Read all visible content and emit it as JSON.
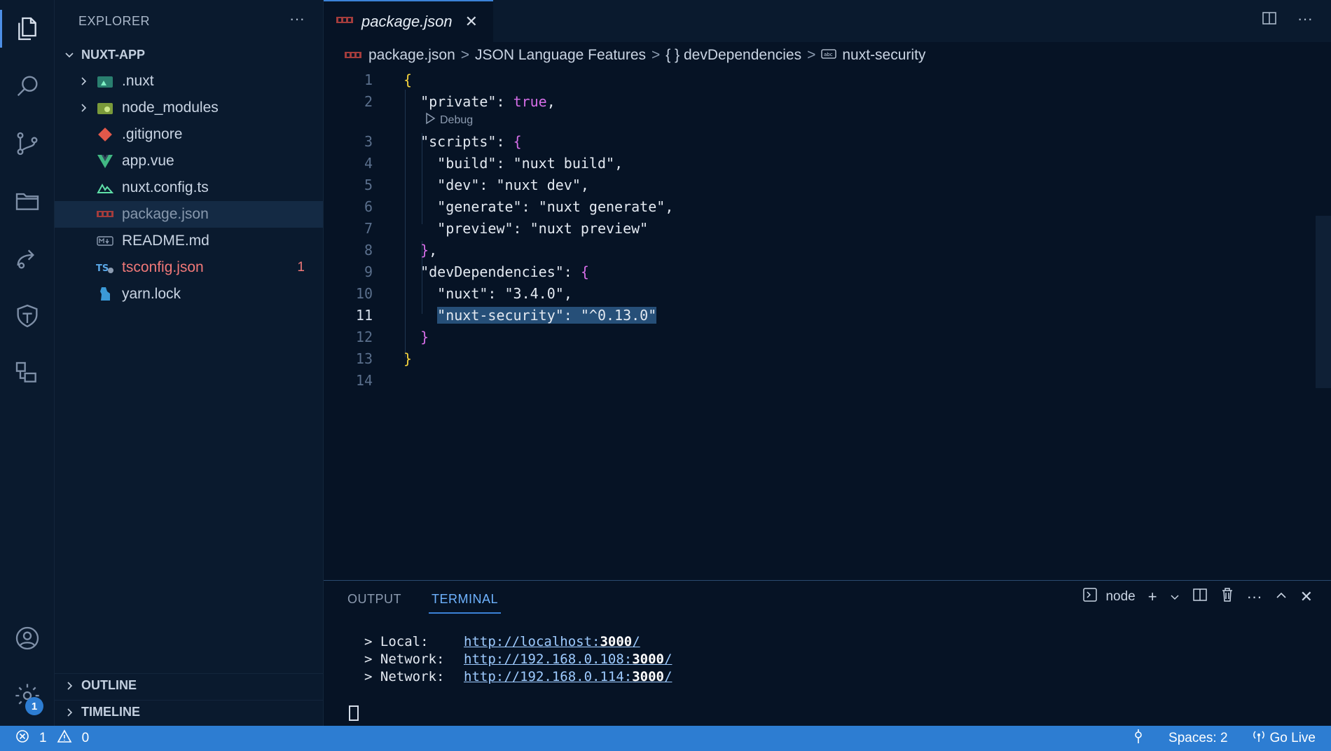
{
  "colors": {
    "accent": "#3b82d8",
    "statusbar": "#2d7dd2",
    "background": "#061325",
    "sidebar": "#0a1a2e"
  },
  "activity": {
    "items": [
      "explorer-icon",
      "search-icon",
      "source-control-icon",
      "folder-icon",
      "remote-icon",
      "shield-icon",
      "extensions-icon"
    ],
    "bottom": [
      "account-icon",
      "gear-icon"
    ],
    "settings_badge": "1"
  },
  "sidebar": {
    "title": "EXPLORER",
    "more": "···",
    "project": "NUXT-APP",
    "files": [
      {
        "label": ".nuxt",
        "icon": "nuxt-folder-icon"
      },
      {
        "label": "node_modules",
        "icon": "node-folder-icon"
      },
      {
        "label": ".gitignore",
        "icon": "git-icon"
      },
      {
        "label": "app.vue",
        "icon": "vue-icon"
      },
      {
        "label": "nuxt.config.ts",
        "icon": "nuxt-icon"
      },
      {
        "label": "package.json",
        "icon": "npm-icon"
      },
      {
        "label": "README.md",
        "icon": "markdown-icon"
      },
      {
        "label": "tsconfig.json",
        "icon": "ts-icon",
        "errors": "1"
      },
      {
        "label": "yarn.lock",
        "icon": "yarn-icon"
      }
    ],
    "outline": "OUTLINE",
    "timeline": "TIMELINE"
  },
  "tab": {
    "label": "package.json",
    "close": "✕"
  },
  "breadcrumbs": [
    "package.json",
    "JSON Language Features",
    "{ } devDependencies",
    "nuxt-security"
  ],
  "editor": {
    "codelens": "Debug",
    "line_numbers": [
      "1",
      "2",
      "3",
      "4",
      "5",
      "6",
      "7",
      "8",
      "9",
      "10",
      "11",
      "12",
      "13",
      "14"
    ],
    "lines": {
      "l1": "{",
      "l2_key": "\"private\"",
      "l2_val": "true",
      "l3_key": "\"scripts\"",
      "l3_brace": "{",
      "l4_key": "\"build\"",
      "l4_val": "\"nuxt build\"",
      "l5_key": "\"dev\"",
      "l5_val": "\"nuxt dev\"",
      "l6_key": "\"generate\"",
      "l6_val": "\"nuxt generate\"",
      "l7_key": "\"preview\"",
      "l7_val": "\"nuxt preview\"",
      "l8": "}",
      "l9_key": "\"devDependencies\"",
      "l9_brace": "{",
      "l10_key": "\"nuxt\"",
      "l10_val": "\"3.4.0\"",
      "l11_key": "\"nuxt-security\"",
      "l11_val": "\"^0.13.0\"",
      "l12": "}",
      "l13": "}"
    }
  },
  "panel": {
    "tabs": [
      "OUTPUT",
      "TERMINAL"
    ],
    "active_tab": "TERMINAL",
    "shell": "node",
    "terminal": [
      {
        "label": "> Local:",
        "url_pre": "http://localhost:",
        "port": "3000",
        "url_post": "/"
      },
      {
        "label": "> Network:",
        "url_pre": "http://192.168.0.108:",
        "port": "3000",
        "url_post": "/"
      },
      {
        "label": "> Network:",
        "url_pre": "http://192.168.0.114:",
        "port": "3000",
        "url_post": "/"
      }
    ]
  },
  "status": {
    "errors": "1",
    "warnings": "0",
    "spaces": "Spaces: 2",
    "golive": "Go Live"
  }
}
